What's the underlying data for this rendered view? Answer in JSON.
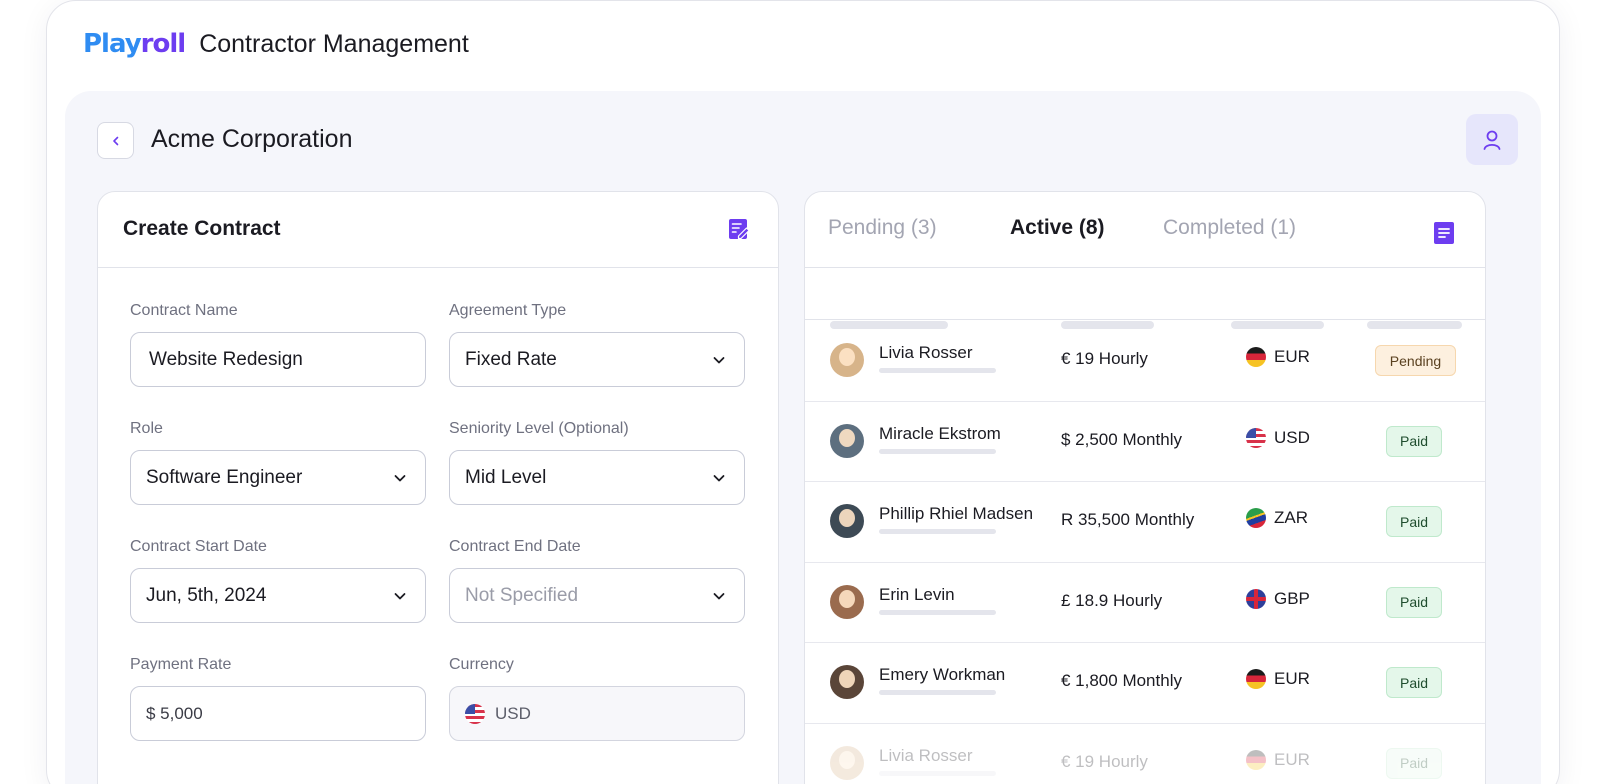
{
  "header": {
    "logo_play": "Play",
    "logo_roll": "roll",
    "title": "Contractor Management"
  },
  "company": {
    "name": "Acme Corporation"
  },
  "create_contract": {
    "title": "Create Contract",
    "fields": {
      "contract_name": {
        "label": "Contract Name",
        "value": "Website Redesign"
      },
      "agreement_type": {
        "label": "Agreement Type",
        "value": "Fixed Rate"
      },
      "role": {
        "label": "Role",
        "value": "Software Engineer"
      },
      "seniority": {
        "label": "Seniority Level (Optional)",
        "value": "Mid Level"
      },
      "start_date": {
        "label": "Contract Start Date",
        "value": "Jun, 5th, 2024"
      },
      "end_date": {
        "label": "Contract End Date",
        "placeholder": "Not Specified"
      },
      "payment_rate": {
        "label": "Payment Rate",
        "value": "$ 5,000"
      },
      "currency": {
        "label": "Currency",
        "value": "USD",
        "flag": "us-flag-icon"
      }
    }
  },
  "contracts": {
    "tabs": [
      {
        "label": "Pending (3)",
        "active": false
      },
      {
        "label": "Active (8)",
        "active": true
      },
      {
        "label": "Completed (1)",
        "active": false
      }
    ],
    "rows": [
      {
        "name": "Livia Rosser",
        "rate": "€ 19 Hourly",
        "currency": "EUR",
        "status": "Pending",
        "avatar_color": "#d7b48a"
      },
      {
        "name": "Miracle Ekstrom",
        "rate": "$ 2,500 Monthly",
        "currency": "USD",
        "status": "Paid",
        "avatar_color": "#5d6f7f"
      },
      {
        "name": "Phillip Rhiel Madsen",
        "rate": "R 35,500 Monthly",
        "currency": "ZAR",
        "status": "Paid",
        "avatar_color": "#3d4a55"
      },
      {
        "name": "Erin Levin",
        "rate": "£ 18.9 Hourly",
        "currency": "GBP",
        "status": "Paid",
        "avatar_color": "#9a6b4e"
      },
      {
        "name": "Emery Workman",
        "rate": "€ 1,800 Monthly",
        "currency": "EUR",
        "status": "Paid",
        "avatar_color": "#5a4538"
      },
      {
        "name": "Livia Rosser",
        "rate": "€ 19 Hourly",
        "currency": "EUR",
        "status": "Paid",
        "avatar_color": "#d7b48a"
      }
    ]
  },
  "colors": {
    "accent": "#6d3df0",
    "logo_blue": "#2f8cf2",
    "pending_bg": "#fdf0df",
    "paid_bg": "#e4f7ea"
  }
}
